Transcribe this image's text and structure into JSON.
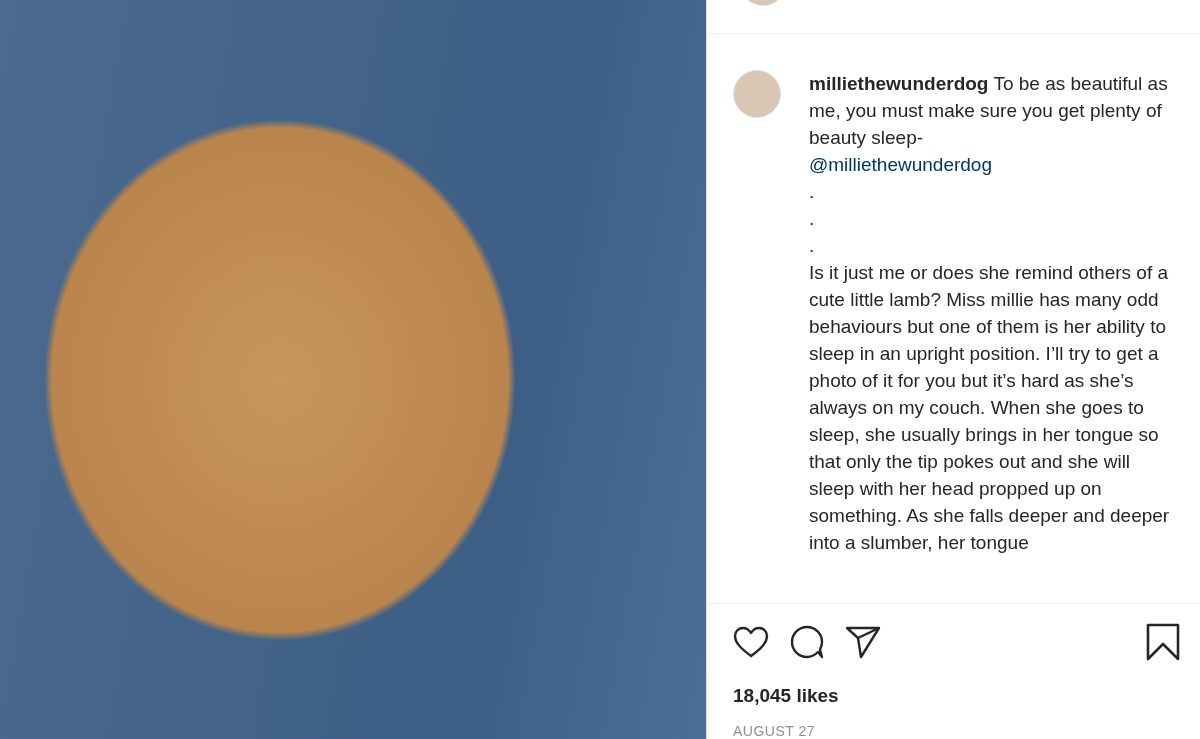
{
  "caption": {
    "text": "**milliethewunderdog** To be as beautiful as me, you must make sure you get plenty of beauty sleep-",
    "mention": "@milliethewunderdog",
    "dots": [
      ".",
      ".",
      "."
    ],
    "body": "Is it just me or does she remind others of a cute little lamb? Miss millie has many odd behaviours but one of them is her ability to sleep in an upright position. I’ll try to get a photo of it for you but it’s hard as she’s always on my couch. When she goes to sleep, she usually brings in her tongue so that only the tip pokes out and she will sleep with her head propped up on something. As she falls deeper and deeper into a slumber, her tongue"
  },
  "likes": "18,045 likes",
  "date": "AUGUST 27"
}
